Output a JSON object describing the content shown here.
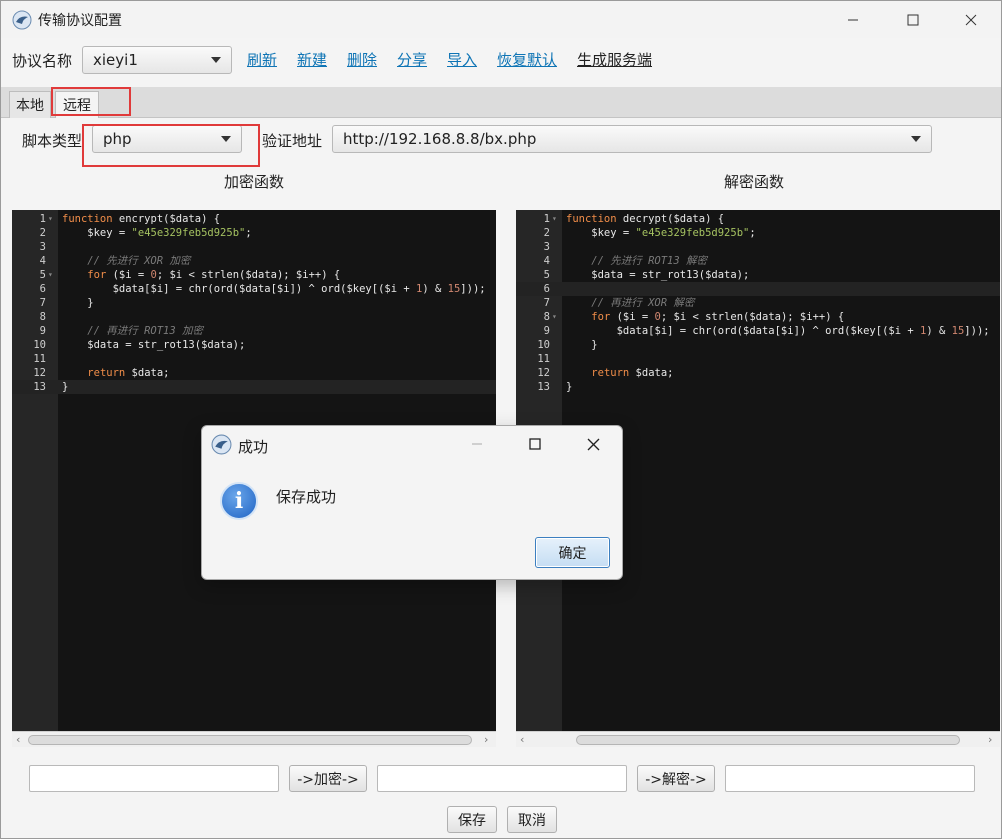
{
  "window": {
    "title": "传输协议配置"
  },
  "toolbar": {
    "protocol_label": "协议名称",
    "protocol_value": "xieyi1",
    "links": [
      "刷新",
      "新建",
      "删除",
      "分享",
      "导入",
      "恢复默认",
      "生成服务端"
    ]
  },
  "tabs": [
    "本地",
    "远程"
  ],
  "remote": {
    "script_type_label": "脚本类型",
    "script_type_value": "php",
    "verify_url_label": "验证地址",
    "verify_url_value": "http://192.168.8.8/bx.php"
  },
  "encrypt": {
    "title": "加密函数",
    "lines": [
      "function encrypt($data) {",
      "    $key = \"e45e329feb5d925b\";",
      "",
      "    // 先进行 XOR 加密",
      "    for ($i = 0; $i < strlen($data); $i++) {",
      "        $data[$i] = chr(ord($data[$i]) ^ ord($key[($i + 1) & 15]));",
      "    }",
      "",
      "    // 再进行 ROT13 加密",
      "    $data = str_rot13($data);",
      "",
      "    return $data;",
      "}"
    ]
  },
  "decrypt": {
    "title": "解密函数",
    "lines": [
      "function decrypt($data) {",
      "    $key = \"e45e329feb5d925b\";",
      "",
      "    // 先进行 ROT13 解密",
      "    $data = str_rot13($data);",
      "",
      "    // 再进行 XOR 解密",
      "    for ($i = 0; $i < strlen($data); $i++) {",
      "        $data[$i] = chr(ord($data[$i]) ^ ord($key[($i + 1) & 15]));",
      "    }",
      "",
      "    return $data;",
      "}"
    ]
  },
  "bottom": {
    "encrypt_button": "->加密->",
    "decrypt_button": "->解密->",
    "save_button": "保存",
    "cancel_button": "取消"
  },
  "dialog": {
    "title": "成功",
    "message": "保存成功",
    "ok_button": "确定",
    "info_icon": "i"
  },
  "colors": {
    "link": "#0e74b5",
    "highlight_box": "#e03a3a",
    "editor_bg": "#141414"
  }
}
